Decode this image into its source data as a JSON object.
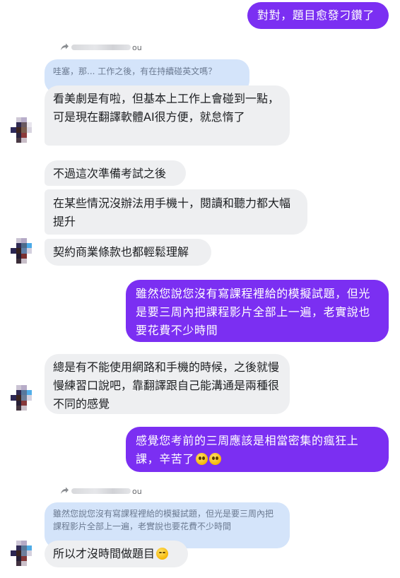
{
  "conversation": {
    "m1": "對對，題目愈發刁鑽了",
    "reply1": {
      "name_suffix": "ou",
      "quote": "哇塞，那... 工作之後，有在持續碰英文嗎？"
    },
    "m2": "看美劇是有啦，但基本上工作上會碰到一點，可是現在翻譯軟體AI很方便，就怠惰了",
    "m3": "不過這次準備考試之後",
    "m4": "在某些情況沒辦法用手機十，閱讀和聽力都大幅提升",
    "m5": "契約商業條款也都輕鬆理解",
    "m6": "雖然您說您沒有寫課程裡給的模擬試題，但光是要三周內把課程影片全部上一遍，老實說也要花費不少時間",
    "m7": "總是有不能使用網路和手機的時候，之後就慢慢練習口說吧，靠翻譯跟自己能溝通是兩種很不同的感覺",
    "m8": "感覺您考前的三周應該是相當密集的瘋狂上課，辛苦了",
    "reply2": {
      "name_suffix": "ou",
      "quote": "雖然您說您沒有寫課程裡給的模擬試題，但光是要三周內把課程影片全部上一遍，老實說也要花費不少時間"
    },
    "m9": "所以才沒時間做題目"
  },
  "colors": {
    "outgoing_bubble": "#7b2ff2",
    "incoming_bubble": "#eeeff1",
    "quoted_bubble": "#d4e4fa"
  },
  "icons": {
    "reply": "reply-arrow-icon",
    "emoji_cry": "pleading-face-emoji",
    "emoji_laugh": "laughing-emoji"
  }
}
